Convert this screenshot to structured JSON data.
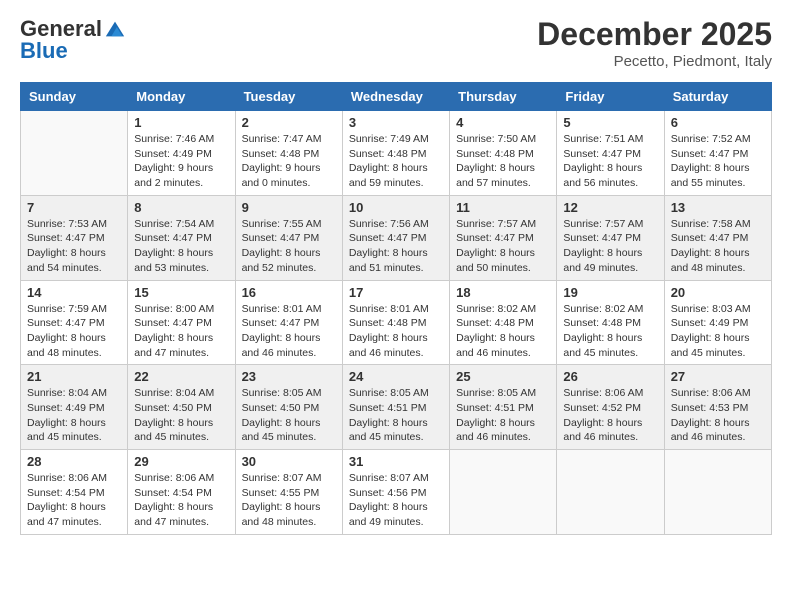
{
  "header": {
    "logo_general": "General",
    "logo_blue": "Blue",
    "month_title": "December 2025",
    "subtitle": "Pecetto, Piedmont, Italy"
  },
  "days_of_week": [
    "Sunday",
    "Monday",
    "Tuesday",
    "Wednesday",
    "Thursday",
    "Friday",
    "Saturday"
  ],
  "weeks": [
    [
      {
        "day": "",
        "info": ""
      },
      {
        "day": "1",
        "info": "Sunrise: 7:46 AM\nSunset: 4:49 PM\nDaylight: 9 hours\nand 2 minutes."
      },
      {
        "day": "2",
        "info": "Sunrise: 7:47 AM\nSunset: 4:48 PM\nDaylight: 9 hours\nand 0 minutes."
      },
      {
        "day": "3",
        "info": "Sunrise: 7:49 AM\nSunset: 4:48 PM\nDaylight: 8 hours\nand 59 minutes."
      },
      {
        "day": "4",
        "info": "Sunrise: 7:50 AM\nSunset: 4:48 PM\nDaylight: 8 hours\nand 57 minutes."
      },
      {
        "day": "5",
        "info": "Sunrise: 7:51 AM\nSunset: 4:47 PM\nDaylight: 8 hours\nand 56 minutes."
      },
      {
        "day": "6",
        "info": "Sunrise: 7:52 AM\nSunset: 4:47 PM\nDaylight: 8 hours\nand 55 minutes."
      }
    ],
    [
      {
        "day": "7",
        "info": "Sunrise: 7:53 AM\nSunset: 4:47 PM\nDaylight: 8 hours\nand 54 minutes."
      },
      {
        "day": "8",
        "info": "Sunrise: 7:54 AM\nSunset: 4:47 PM\nDaylight: 8 hours\nand 53 minutes."
      },
      {
        "day": "9",
        "info": "Sunrise: 7:55 AM\nSunset: 4:47 PM\nDaylight: 8 hours\nand 52 minutes."
      },
      {
        "day": "10",
        "info": "Sunrise: 7:56 AM\nSunset: 4:47 PM\nDaylight: 8 hours\nand 51 minutes."
      },
      {
        "day": "11",
        "info": "Sunrise: 7:57 AM\nSunset: 4:47 PM\nDaylight: 8 hours\nand 50 minutes."
      },
      {
        "day": "12",
        "info": "Sunrise: 7:57 AM\nSunset: 4:47 PM\nDaylight: 8 hours\nand 49 minutes."
      },
      {
        "day": "13",
        "info": "Sunrise: 7:58 AM\nSunset: 4:47 PM\nDaylight: 8 hours\nand 48 minutes."
      }
    ],
    [
      {
        "day": "14",
        "info": "Sunrise: 7:59 AM\nSunset: 4:47 PM\nDaylight: 8 hours\nand 48 minutes."
      },
      {
        "day": "15",
        "info": "Sunrise: 8:00 AM\nSunset: 4:47 PM\nDaylight: 8 hours\nand 47 minutes."
      },
      {
        "day": "16",
        "info": "Sunrise: 8:01 AM\nSunset: 4:47 PM\nDaylight: 8 hours\nand 46 minutes."
      },
      {
        "day": "17",
        "info": "Sunrise: 8:01 AM\nSunset: 4:48 PM\nDaylight: 8 hours\nand 46 minutes."
      },
      {
        "day": "18",
        "info": "Sunrise: 8:02 AM\nSunset: 4:48 PM\nDaylight: 8 hours\nand 46 minutes."
      },
      {
        "day": "19",
        "info": "Sunrise: 8:02 AM\nSunset: 4:48 PM\nDaylight: 8 hours\nand 45 minutes."
      },
      {
        "day": "20",
        "info": "Sunrise: 8:03 AM\nSunset: 4:49 PM\nDaylight: 8 hours\nand 45 minutes."
      }
    ],
    [
      {
        "day": "21",
        "info": "Sunrise: 8:04 AM\nSunset: 4:49 PM\nDaylight: 8 hours\nand 45 minutes."
      },
      {
        "day": "22",
        "info": "Sunrise: 8:04 AM\nSunset: 4:50 PM\nDaylight: 8 hours\nand 45 minutes."
      },
      {
        "day": "23",
        "info": "Sunrise: 8:05 AM\nSunset: 4:50 PM\nDaylight: 8 hours\nand 45 minutes."
      },
      {
        "day": "24",
        "info": "Sunrise: 8:05 AM\nSunset: 4:51 PM\nDaylight: 8 hours\nand 45 minutes."
      },
      {
        "day": "25",
        "info": "Sunrise: 8:05 AM\nSunset: 4:51 PM\nDaylight: 8 hours\nand 46 minutes."
      },
      {
        "day": "26",
        "info": "Sunrise: 8:06 AM\nSunset: 4:52 PM\nDaylight: 8 hours\nand 46 minutes."
      },
      {
        "day": "27",
        "info": "Sunrise: 8:06 AM\nSunset: 4:53 PM\nDaylight: 8 hours\nand 46 minutes."
      }
    ],
    [
      {
        "day": "28",
        "info": "Sunrise: 8:06 AM\nSunset: 4:54 PM\nDaylight: 8 hours\nand 47 minutes."
      },
      {
        "day": "29",
        "info": "Sunrise: 8:06 AM\nSunset: 4:54 PM\nDaylight: 8 hours\nand 47 minutes."
      },
      {
        "day": "30",
        "info": "Sunrise: 8:07 AM\nSunset: 4:55 PM\nDaylight: 8 hours\nand 48 minutes."
      },
      {
        "day": "31",
        "info": "Sunrise: 8:07 AM\nSunset: 4:56 PM\nDaylight: 8 hours\nand 49 minutes."
      },
      {
        "day": "",
        "info": ""
      },
      {
        "day": "",
        "info": ""
      },
      {
        "day": "",
        "info": ""
      }
    ]
  ]
}
